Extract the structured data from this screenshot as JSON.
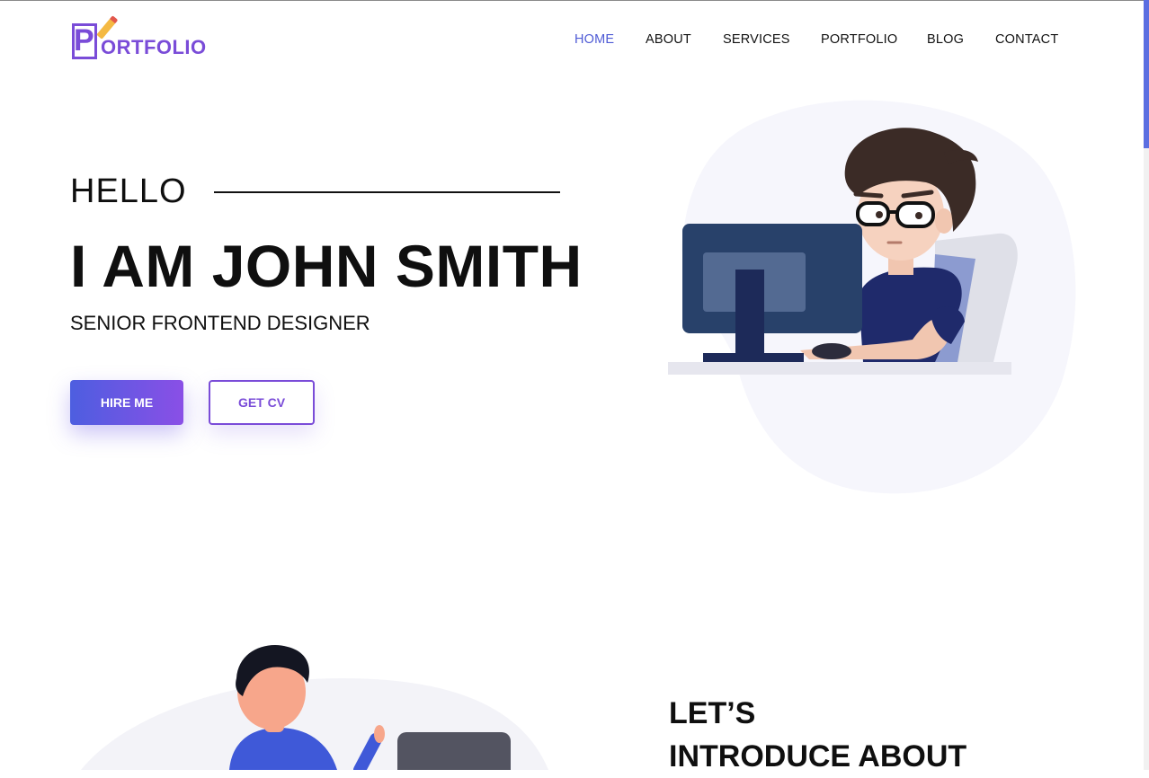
{
  "logo": {
    "initial": "P",
    "text": "ORTFOLIO"
  },
  "nav": {
    "items": [
      {
        "label": "HOME",
        "active": true
      },
      {
        "label": "ABOUT",
        "active": false
      },
      {
        "label": "SERVICES",
        "active": false
      },
      {
        "label": "PORTFOLIO",
        "active": false
      },
      {
        "label": "BLOG",
        "active": false
      },
      {
        "label": "CONTACT",
        "active": false
      }
    ]
  },
  "hero": {
    "greeting": "HELLO",
    "name": "I AM JOHN SMITH",
    "role": "SENIOR FRONTEND DESIGNER",
    "hire_label": "HIRE ME",
    "cv_label": "GET CV"
  },
  "intro": {
    "line1": "LET’S",
    "line2": "INTRODUCE ABOUT"
  },
  "colors": {
    "accent": "#4f5bd5",
    "brand": "#7a4cd8",
    "gradient_start": "#4d5ee0",
    "gradient_end": "#8a4fe6"
  }
}
